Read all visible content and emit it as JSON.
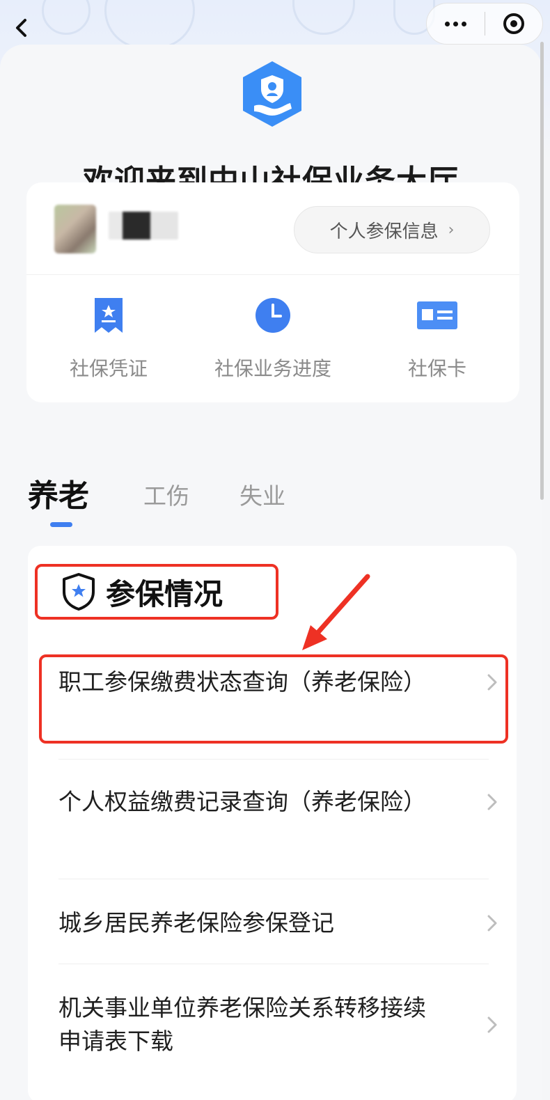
{
  "nav": {
    "back": "‹",
    "more": "more-icon",
    "close": "close-mini-program-icon"
  },
  "header": {
    "welcome": "欢迎来到中山社保业务大厅"
  },
  "user_card": {
    "info_button": "个人参保信息",
    "info_chevron": "›",
    "quick_actions": [
      {
        "label": "社保凭证",
        "icon": "voucher-icon"
      },
      {
        "label": "社保业务进度",
        "icon": "clock-icon"
      },
      {
        "label": "社保卡",
        "icon": "card-icon"
      }
    ]
  },
  "tabs": [
    {
      "label": "养老",
      "active": true
    },
    {
      "label": "工伤",
      "active": false
    },
    {
      "label": "失业",
      "active": false
    }
  ],
  "section": {
    "title": "参保情况",
    "items": [
      {
        "label": "职工参保缴费状态查询（养老保险）",
        "highlighted": true
      },
      {
        "label": "个人权益缴费记录查询（养老保险）"
      },
      {
        "label": "城乡居民养老保险参保登记"
      },
      {
        "label": "机关事业单位养老保险关系转移接续申请表下载"
      }
    ]
  },
  "colors": {
    "accent": "#3f7ff0",
    "highlight": "#ee3124",
    "logo": "#3a8ef6"
  }
}
